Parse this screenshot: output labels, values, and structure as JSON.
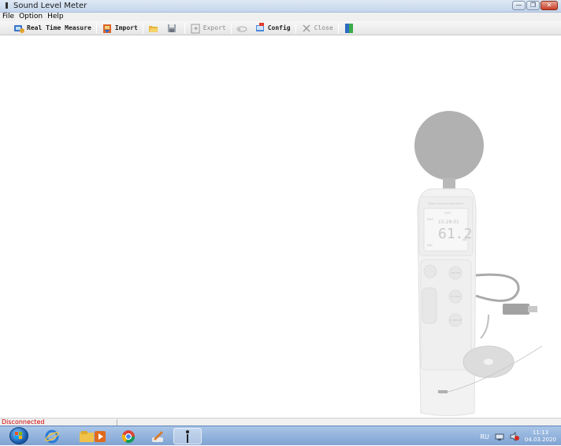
{
  "window": {
    "title": "Sound Level Meter"
  },
  "menu": {
    "items": [
      "File",
      "Option",
      "Help"
    ]
  },
  "toolbar": {
    "real_time_label": "Real Time Measure",
    "import_label": "Import",
    "export_label": "Export",
    "config_label": "Config",
    "close_label": "Close"
  },
  "device": {
    "brand_text": "Digital Sound Level Meter",
    "display_value": "61.2",
    "display_unit": "dB",
    "mode_text": "FAST",
    "time_text": "15:28:01",
    "max_label": "MAX",
    "min_label": "MIN",
    "button_labels": [
      "MAX MIN",
      "A/C CLEAR",
      "F/S RECORD"
    ]
  },
  "status": {
    "text": "Disconnected"
  },
  "taskbar": {
    "language": "RU",
    "time": "11:13",
    "date": "04.03.2020",
    "pinned": [
      "start-button",
      "internet-explorer",
      "file-explorer",
      "media-player",
      "chrome",
      "paint",
      "sound-meter-app"
    ]
  },
  "colors": {
    "status_error": "#d00000",
    "titlebar": "#c4d6ec",
    "taskbar": "#7fa3d2"
  }
}
